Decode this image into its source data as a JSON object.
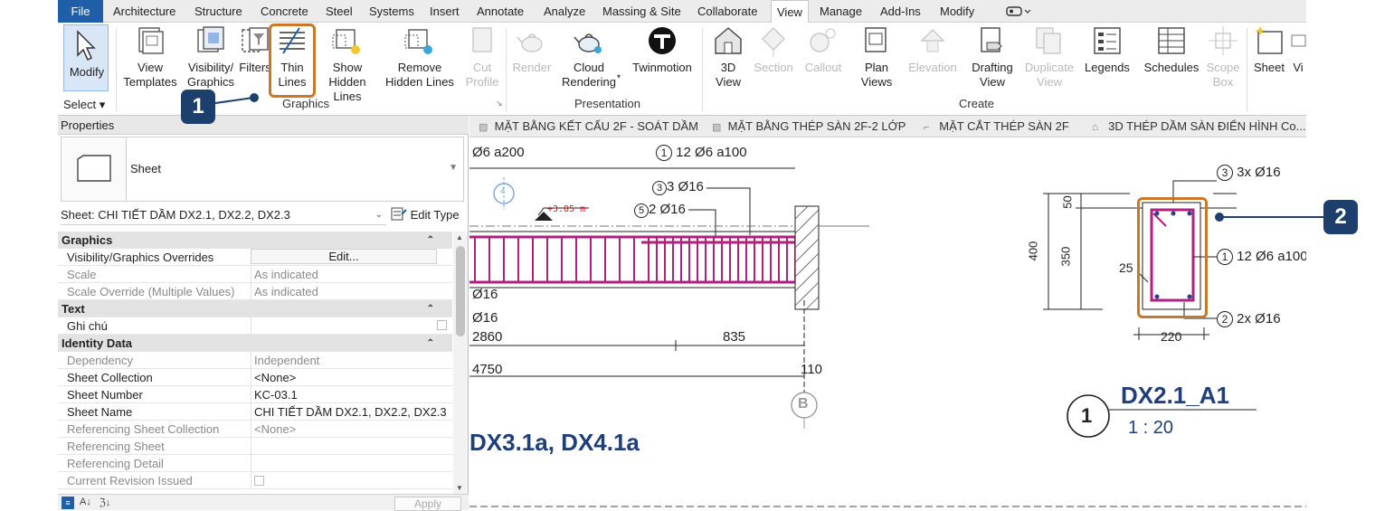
{
  "menu": {
    "tabs": [
      "File",
      "Architecture",
      "Structure",
      "Concrete",
      "Steel",
      "Systems",
      "Insert",
      "Annotate",
      "Analyze",
      "Massing & Site",
      "Collaborate",
      "View",
      "Manage",
      "Add-Ins",
      "Modify"
    ],
    "active": "View"
  },
  "ribbon": {
    "modify": "Modify",
    "select": "Select ▾",
    "view_templates": "View\nTemplates",
    "visibility": "Visibility/\nGraphics",
    "filters": "Filters",
    "thin_lines": "Thin\nLines",
    "show_hidden": "Show\nHidden Lines",
    "remove_hidden": "Remove\nHidden Lines",
    "cut_profile": "Cut\nProfile",
    "render": "Render",
    "cloud_rendering": "Cloud\nRendering",
    "twinmotion": "Twinmotion",
    "view_3d": "3D\nView",
    "section": "Section",
    "callout": "Callout",
    "plan_views": "Plan\nViews",
    "elevation": "Elevation",
    "drafting_view": "Drafting\nView",
    "duplicate_view": "Duplicate\nView",
    "legends": "Legends",
    "schedules": "Schedules",
    "scope_box": "Scope\nBox",
    "sheet": "Sheet",
    "vi": "Vi",
    "panel_graphics": "Graphics",
    "panel_presentation": "Presentation",
    "panel_create": "Create"
  },
  "callouts": {
    "one": "1",
    "two": "2"
  },
  "properties": {
    "title": "Properties",
    "type_name": "Sheet",
    "selector": "Sheet: CHI TIẾT DẦM DX2.1, DX2.2, DX2.3",
    "edit_type": "Edit Type",
    "rows": [
      {
        "k": "Graphics",
        "hdr": true
      },
      {
        "k": "Visibility/Graphics Overrides",
        "v": "Edit..."
      },
      {
        "k": "Scale",
        "v": "As indicated",
        "grey": true
      },
      {
        "k": "Scale Override (Multiple Values)",
        "v": "As indicated",
        "grey": true
      },
      {
        "k": "Text",
        "hdr": true
      },
      {
        "k": "Ghi chú",
        "v": ""
      },
      {
        "k": "Identity Data",
        "hdr": true
      },
      {
        "k": "Dependency",
        "v": "Independent",
        "grey": true
      },
      {
        "k": "Sheet Collection",
        "v": "<None>"
      },
      {
        "k": "Sheet Number",
        "v": "KC-03.1"
      },
      {
        "k": "Sheet Name",
        "v": "CHI TIẾT DẦM DX2.1, DX2.2, DX2.3"
      },
      {
        "k": "Referencing Sheet Collection",
        "v": "<None>",
        "grey": true
      },
      {
        "k": "Referencing Sheet",
        "v": "",
        "grey": true
      },
      {
        "k": "Referencing Detail",
        "v": "",
        "grey": true
      },
      {
        "k": "Current Revision Issued",
        "v": "",
        "grey": true
      }
    ],
    "apply": "Apply"
  },
  "view_tabs": [
    "MẶT BẰNG KẾT CẤU 2F - SOÁT DẦM",
    "MẶT BẰNG THÉP SÀN 2F-2 LỚP",
    "MẶT CẮT THÉP SÀN 2F",
    "3D THÉP DẦM SÀN ĐIỂN HÌNH Co..."
  ],
  "drawing": {
    "t1": "Ø6 a200",
    "t2": "12 Ø6 a100",
    "t2n": "1",
    "t3": "3 Ø16",
    "t3n": "3",
    "t4": "2 Ø16",
    "t4n": "5",
    "elev": "+3.85 m",
    "grid4": "4",
    "t5": "Ø16",
    "t6": "Ø16",
    "t7": "2860",
    "t8": "835",
    "t9": "4750",
    "t10": "110",
    "gridB": "B",
    "title_left": "DX3.1a, DX4.1a",
    "s_top": "3x Ø16",
    "s_topn": "3",
    "s_mid": "12 Ø6 a100",
    "s_midn": "1",
    "s_bot": "2x Ø16",
    "s_botn": "2",
    "d50": "50",
    "d350": "350",
    "d400": "400",
    "d25": "25",
    "d220": "220",
    "sec_title": "DX2.1_A1",
    "sec_num": "1",
    "sec_scale": "1 : 20"
  },
  "colors": {
    "accent": "#1e5fa8",
    "callout": "#c8782a",
    "badge": "#1c3f6e",
    "rebar": "#b0207e"
  }
}
